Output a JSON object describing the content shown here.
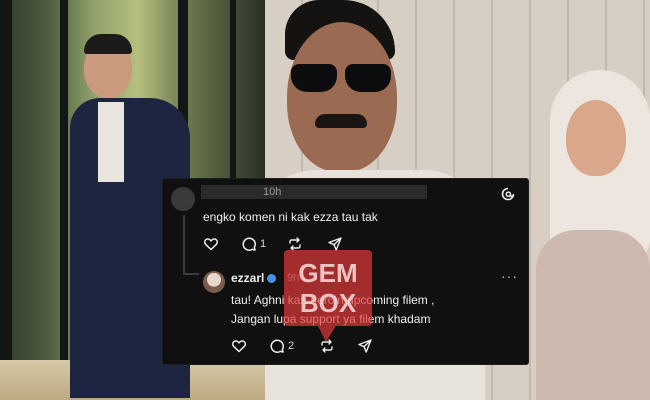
{
  "comment_card": {
    "top_comment": {
      "time": "10h",
      "text": "engko komen ni kak ezza tau tak",
      "repost_count": "1"
    },
    "reply": {
      "username": "ezzarl",
      "time": "9h",
      "line1": "tau! Aghni kan heroin upcoming filem ,",
      "line2": "Jangan lupa support ya filem khadam",
      "repost_count": "2",
      "more_label": "···"
    },
    "icons": [
      "threads-logo-icon",
      "heart-icon",
      "comment-icon",
      "repost-icon",
      "share-icon"
    ]
  },
  "watermark": {
    "line1": "GEM",
    "line2": "BOX",
    "color": "#e23b3b"
  }
}
